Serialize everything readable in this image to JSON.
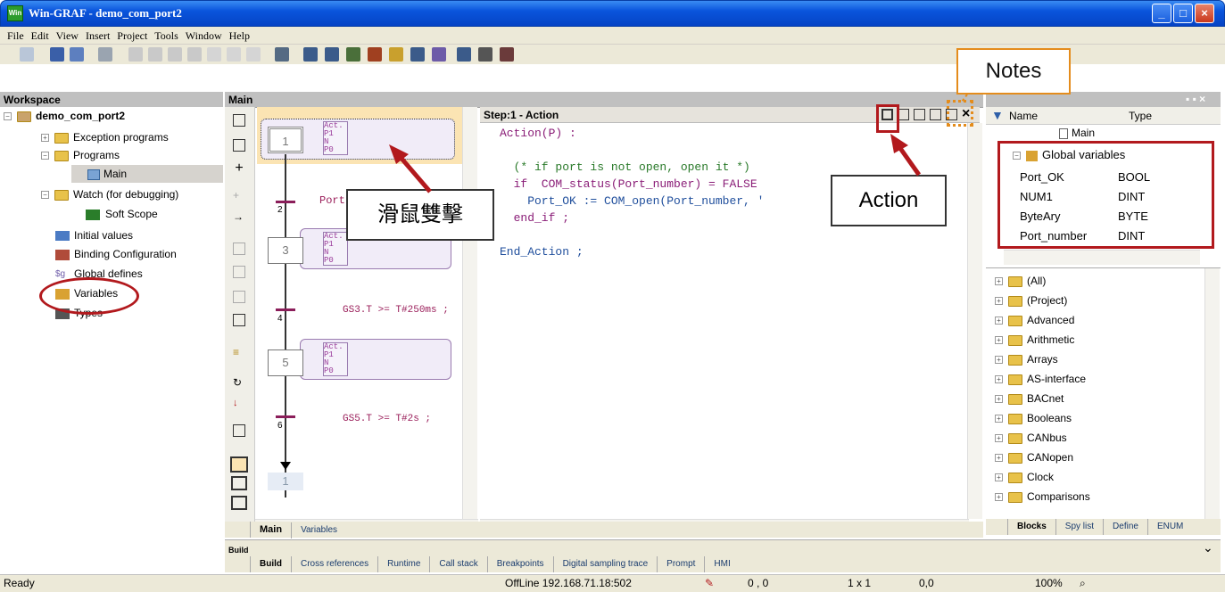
{
  "window": {
    "title": "Win-GRAF  - demo_com_port2",
    "logo": "Win",
    "min": "_",
    "max": "□",
    "close": "×"
  },
  "menu": [
    "File",
    "Edit",
    "View",
    "Insert",
    "Project",
    "Tools",
    "Window",
    "Help"
  ],
  "workspace": {
    "header": "Workspace",
    "root": "demo_com_port2",
    "items": [
      "Exception programs",
      "Programs",
      "Main",
      "Watch (for debugging)",
      "Soft Scope",
      "Initial values",
      "Binding Configuration",
      "Global defines",
      "Variables",
      "Types"
    ]
  },
  "main_header": "Main",
  "sfc": {
    "steps": [
      "1",
      "3",
      "5"
    ],
    "trans": [
      "2",
      "4",
      "6"
    ],
    "tags": [
      "Act.",
      "P1",
      "N",
      "P0"
    ],
    "final": "1",
    "cond2": "Port",
    "cond4": "GS3.T >= T#250ms ;",
    "cond6": "GS5.T >= T#2s ;"
  },
  "action": {
    "header": "Step:1 - Action",
    "lines": [
      "Action(P) :",
      "",
      "  (* if port is not open, open it *)",
      "  if  COM_status(Port_number) = FALSE",
      "    Port_OK := COM_open(Port_number, '",
      "  end_if ;",
      "",
      "End_Action ;"
    ]
  },
  "vars": {
    "col_name": "Name",
    "col_type": "Type",
    "main": "Main",
    "group": "Global variables",
    "rows": [
      [
        "Port_OK",
        "BOOL"
      ],
      [
        "NUM1",
        "DINT"
      ],
      [
        "ByteAry",
        "BYTE"
      ],
      [
        "Port_number",
        "DINT"
      ]
    ]
  },
  "library": [
    "(All)",
    "(Project)",
    "Advanced",
    "Arithmetic",
    "Arrays",
    "AS-interface",
    "BACnet",
    "Booleans",
    "CANbus",
    "CANopen",
    "Clock",
    "Comparisons"
  ],
  "lib_tabs": [
    "Blocks",
    "Spy list",
    "Define",
    "ENUM"
  ],
  "editor_tabs": [
    "Main",
    "Variables"
  ],
  "build_header": "Build",
  "bottom_tabs": [
    "Build",
    "Cross references",
    "Runtime",
    "Call stack",
    "Breakpoints",
    "Digital sampling trace",
    "Prompt",
    "HMI"
  ],
  "status": {
    "ready": "Ready",
    "conn": "OffLine 192.168.71.18:502",
    "pos": "0 , 0",
    "size": "1 x 1",
    "coord": "0,0",
    "zoom": "100%"
  },
  "annotations": {
    "notes": "Notes",
    "action": "Action",
    "dblclick": "滑鼠雙擊"
  }
}
